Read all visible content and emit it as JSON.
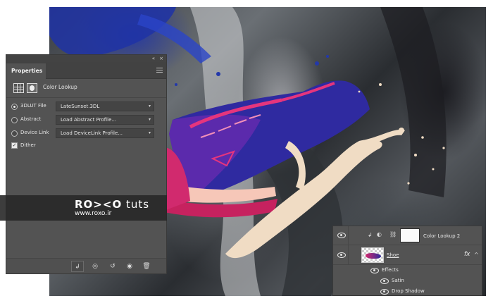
{
  "properties_panel": {
    "collapse_glyph": "«",
    "close_glyph": "×",
    "tab_label": "Properties",
    "adjustment_title": "Color Lookup",
    "options": [
      {
        "label": "3DLUT File",
        "value": "LateSunset.3DL",
        "selected": true
      },
      {
        "label": "Abstract",
        "value": "Load Abstract Profile...",
        "selected": false
      },
      {
        "label": "Device Link",
        "value": "Load DeviceLink Profile...",
        "selected": false
      }
    ],
    "dither_label": "Dither",
    "dither_checked": true,
    "bottom_icons": [
      "clip-to-layer-icon",
      "view-previous-icon",
      "reset-icon",
      "visibility-icon",
      "trash-icon"
    ]
  },
  "watermark": {
    "brand_name": "RO><O",
    "brand_suffix": "tuts",
    "site": "www.roxo.ir"
  },
  "layers_panel": {
    "adjustment_layer_name": "Color Lookup 2",
    "shoe_layer_name": "Shoe",
    "fx_label": "fx",
    "effects_label": "Effects",
    "effects": [
      "Satin",
      "Drop Shadow"
    ]
  },
  "colors": {
    "panel_bg": "#535353",
    "shoe_pink": "#d12a6e",
    "shoe_blue": "#2d2a9a",
    "paint_blue": "#2338aa",
    "splash_cream": "#f0dcc4"
  }
}
